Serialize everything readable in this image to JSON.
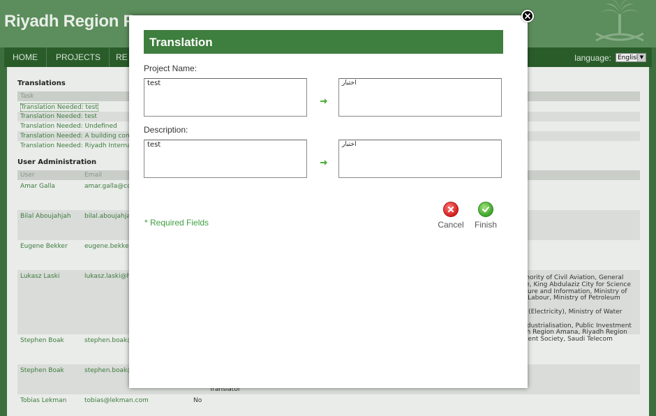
{
  "site": {
    "title": "Riyadh Region F",
    "nav": [
      "HOME",
      "PROJECTS",
      "RE"
    ],
    "language_label": "language:",
    "language_value": "English"
  },
  "translations": {
    "heading": "Translations",
    "column_task": "Task",
    "rows": [
      "Translation Needed: test",
      "Translation Needed: test",
      "Translation Needed: Undefined",
      "Translation Needed: A building complex",
      "Translation Needed: Riyadh International C"
    ]
  },
  "users": {
    "heading": "User Administration",
    "col_user": "User",
    "col_email": "Email",
    "rows": [
      {
        "name": "Amar Galla",
        "email": "amar.galla@conte"
      },
      {
        "name": "Bilal Aboujahjah",
        "email": "bilal.aboujahjah@"
      },
      {
        "name": "Eugene Bekker",
        "email": "eugene.bekker@"
      },
      {
        "name": "Lukasz Laski",
        "email": "lukasz.laski@happ"
      },
      {
        "name": "Stephen Boak",
        "email": "stephen.boak@b"
      },
      {
        "name": "Stephen Boak",
        "email": "stephen.boak@h"
      },
      {
        "name": "Tobias Lekman",
        "email": "tobias@lekman.com",
        "flag": "No"
      }
    ],
    "agencies_lines": [
      "Authority of Civil Aviation, General",
      "Care, King Abdulaziz City for Science",
      "Culture and Information, Ministry of",
      "r of Labour, Ministry of Petroleum and",
      "city (Electricity), Ministry of Water and",
      "d Industrialisation, Public Investment",
      "yadh Region Amana, Riyadh Region",
      "rescent Society, Saudi Telecom"
    ],
    "translator_label": "Translator"
  },
  "modal": {
    "title": "Translation",
    "project_name_label": "Project Name:",
    "project_name_source": "test",
    "project_name_target": "اختبار",
    "description_label": "Description:",
    "description_source": "test",
    "description_target": "اختبار",
    "required_fields": "* Required Fields",
    "cancel_label": "Cancel",
    "finish_label": "Finish"
  }
}
